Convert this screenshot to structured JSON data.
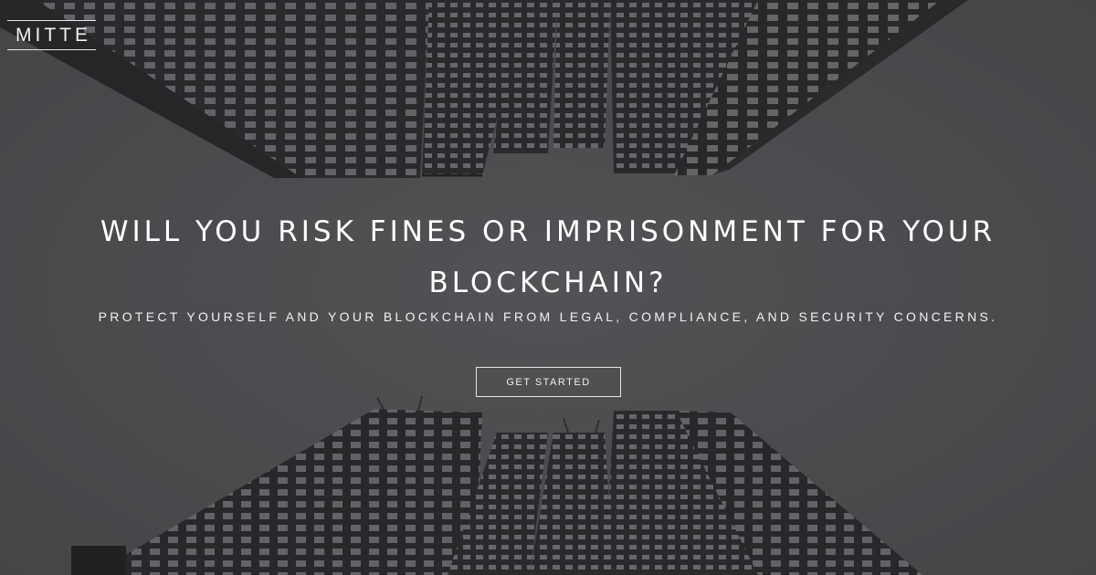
{
  "brand": {
    "logo_text": "MITTE"
  },
  "hero": {
    "headline_line1": "WILL YOU RISK FINES OR IMPRISONMENT FOR YOUR",
    "headline_line2": "BLOCKCHAIN?",
    "subheadline": "PROTECT YOURSELF AND YOUR BLOCKCHAIN FROM LEGAL, COMPLIANCE, AND SECURITY CONCERNS.",
    "cta_label": "GET STARTED"
  },
  "colors": {
    "background": "#4a4b4d",
    "building": "#232324",
    "window": "#6e6e70",
    "text": "#ffffff"
  }
}
